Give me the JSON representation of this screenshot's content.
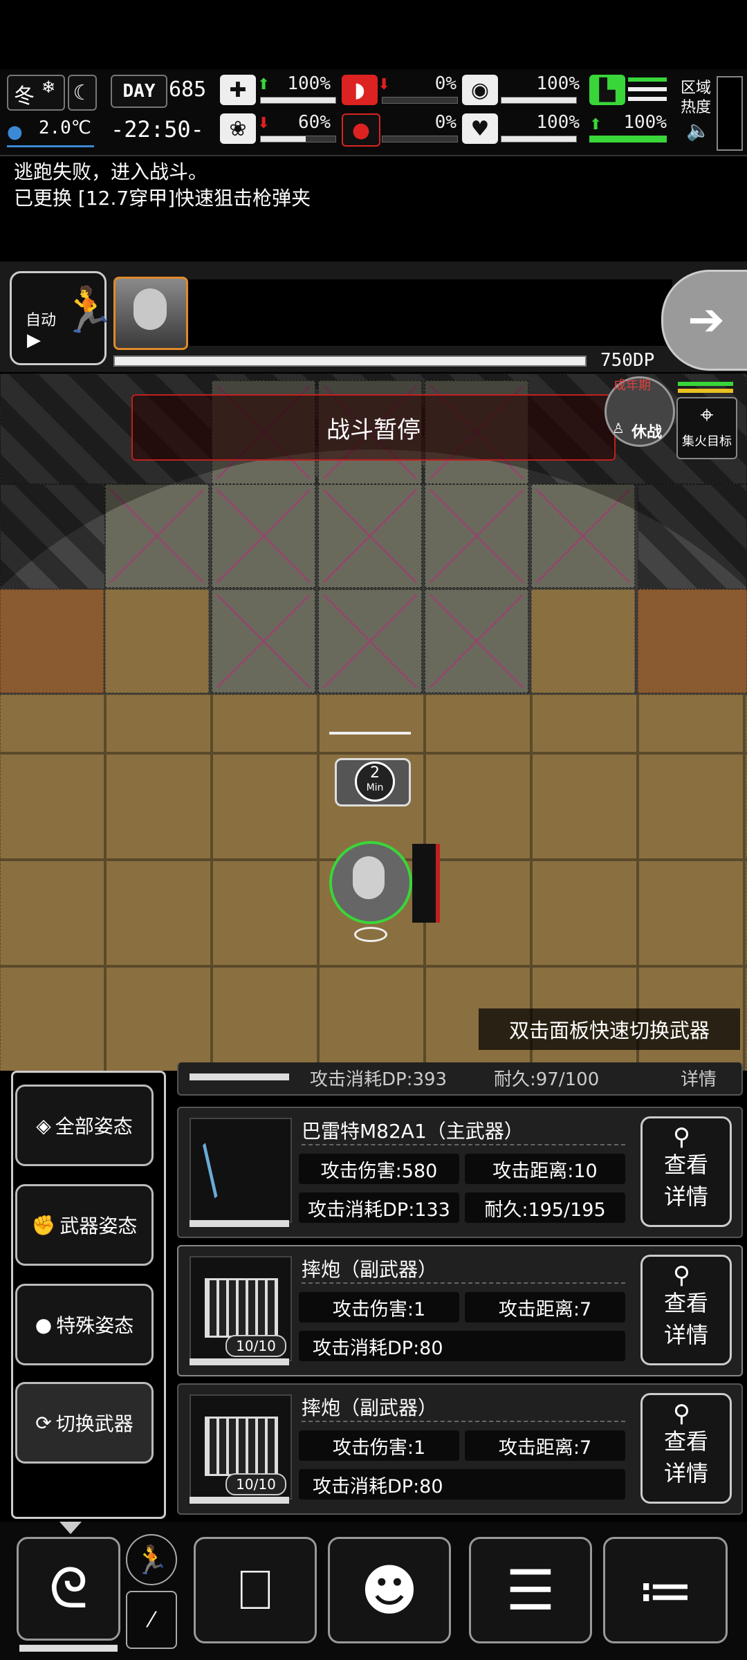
{
  "status": {
    "season": "冬",
    "temperature": "2.0℃",
    "day_label": "DAY",
    "day_number": "685",
    "time": "-22:50-",
    "health_pct": "100%",
    "stamina_pct": "0%",
    "stomach_pct": "100%",
    "leg_pct": "100%",
    "mental_pct": "60%",
    "blood_pct": "0%",
    "heart_pct": "100%",
    "leg2_pct": "100%",
    "region_heat_label": "区域\n热度"
  },
  "log": [
    "逃跑失败，进入战斗。",
    "已更换 [12.7穿甲]快速狙击枪弹夹"
  ],
  "battle": {
    "auto_label": "自动",
    "dp_value": "750DP",
    "pause_text": "战斗暂停",
    "enemy_label_top": "成年期",
    "enemy_status": "休战",
    "focus_fire_label": "集火目标",
    "timer_value": "2",
    "timer_unit": "Min",
    "hint": "双击面板快速切换武器"
  },
  "stances": [
    "全部姿态",
    "武器姿态",
    "特殊姿态",
    "切换武器"
  ],
  "weapons_partial": {
    "stat_a": "攻击消耗DP:393",
    "stat_b": "耐久:97/100",
    "detail": "详情"
  },
  "weapons": [
    {
      "name": "巴雷特M82A1（主武器）",
      "damage": "攻击伤害:580",
      "range": "攻击距离:10",
      "dp_cost": "攻击消耗DP:133",
      "durability": "耐久:195/195",
      "detail_1": "查看",
      "detail_2": "详情"
    },
    {
      "name": "摔炮（副武器）",
      "damage": "攻击伤害:1",
      "range": "攻击距离:7",
      "dp_cost": "攻击消耗DP:80",
      "count": "10/10",
      "detail_1": "查看",
      "detail_2": "详情"
    },
    {
      "name": "摔炮（副武器）",
      "damage": "攻击伤害:1",
      "range": "攻击距离:7",
      "dp_cost": "攻击消耗DP:80",
      "count": "10/10",
      "detail_1": "查看",
      "detail_2": "详情"
    }
  ],
  "colors": {
    "gold_tile": "#8a7040",
    "x_mark": "#8e4a6a",
    "green": "#39d63a",
    "red": "#e02020"
  }
}
